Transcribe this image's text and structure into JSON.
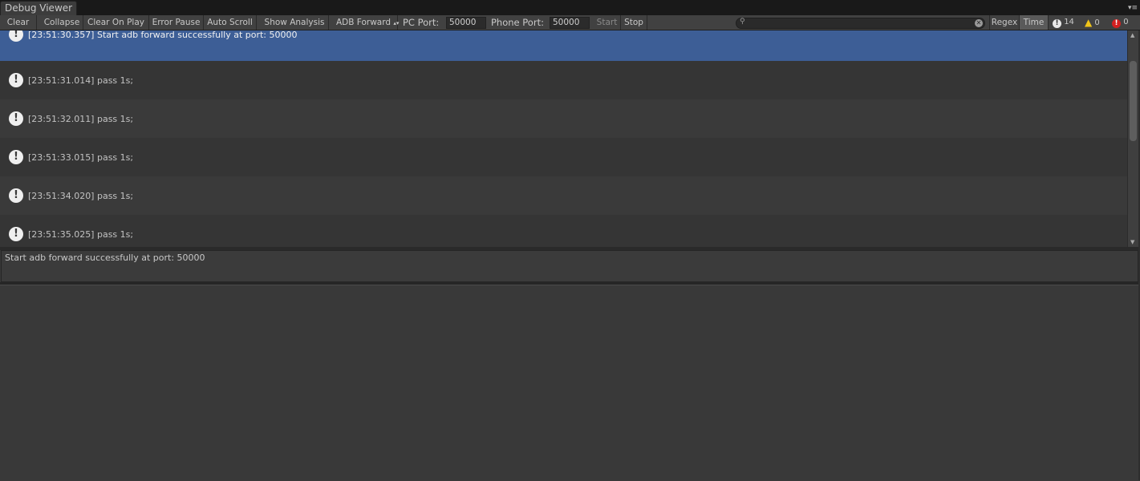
{
  "window": {
    "tab_title": "Debug Viewer"
  },
  "toolbar": {
    "clear": "Clear",
    "collapse": "Collapse",
    "clear_on_play": "Clear On Play",
    "error_pause": "Error Pause",
    "auto_scroll": "Auto Scroll",
    "show_analysis": "Show Analysis",
    "adb_forward": "ADB Forward",
    "pc_port_label": "PC Port:",
    "pc_port_value": "50000",
    "phone_port_label": "Phone Port:",
    "phone_port_value": "50000",
    "start": "Start",
    "stop": "Stop",
    "regex": "Regex",
    "time": "Time",
    "info_count": "14",
    "warning_count": "0",
    "error_count": "0"
  },
  "logs": [
    {
      "text": "[23:51:30.357] Start adb forward successfully at port: 50000",
      "selected": true
    },
    {
      "text": "[23:51:31.014] pass 1s;"
    },
    {
      "text": "[23:51:32.011] pass 1s;"
    },
    {
      "text": "[23:51:33.015] pass 1s;"
    },
    {
      "text": "[23:51:34.020] pass 1s;"
    },
    {
      "text": "[23:51:35.025] pass 1s;"
    }
  ],
  "detail": {
    "text": "Start adb forward successfully at port: 50000"
  },
  "icons": {
    "info": "info-icon",
    "warning": "warning-icon",
    "error": "error-icon",
    "search": "search-icon"
  },
  "colors": {
    "selected_row": "#3d5e96",
    "error": "#d42020",
    "warning": "#f0c419"
  }
}
